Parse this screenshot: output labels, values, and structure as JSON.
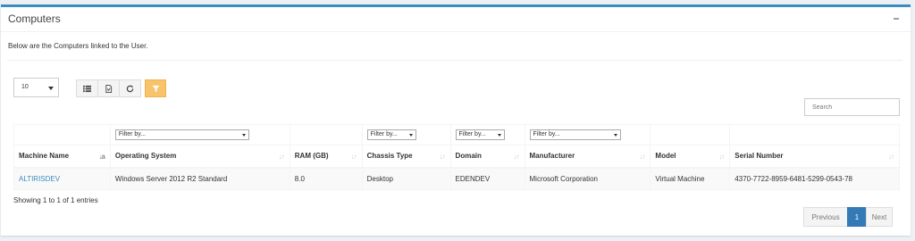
{
  "panel": {
    "title": "Computers",
    "description": "Below are the Computers linked to the User."
  },
  "toolbar": {
    "page_size": "10",
    "buttons": [
      "list-icon",
      "export-icon",
      "refresh-icon"
    ],
    "filter_icon": "filter-icon",
    "accent": "#f8c36b"
  },
  "search": {
    "placeholder": "Search"
  },
  "table": {
    "filter_placeholder": "Filter by...",
    "columns": [
      "Machine Name",
      "Operating System",
      "RAM (GB)",
      "Chassis Type",
      "Domain",
      "Manufacturer",
      "Model",
      "Serial Number"
    ],
    "rows": [
      {
        "machine_name": "ALTIRISDEV",
        "os": "Windows Server 2012 R2 Standard",
        "ram": "8.0",
        "chassis": "Desktop",
        "domain": "EDENDEV",
        "manufacturer": "Microsoft Corporation",
        "model": "Virtual Machine",
        "serial": "4370-7722-8959-6481-5299-0543-78"
      }
    ]
  },
  "footer": {
    "info": "Showing 1 to 1 of 1 entries",
    "pager": {
      "prev": "Previous",
      "current": "1",
      "next": "Next"
    }
  },
  "colors": {
    "header_accent": "#3c8dbc",
    "link": "#3c8dbc",
    "active_page": "#337ab7"
  }
}
